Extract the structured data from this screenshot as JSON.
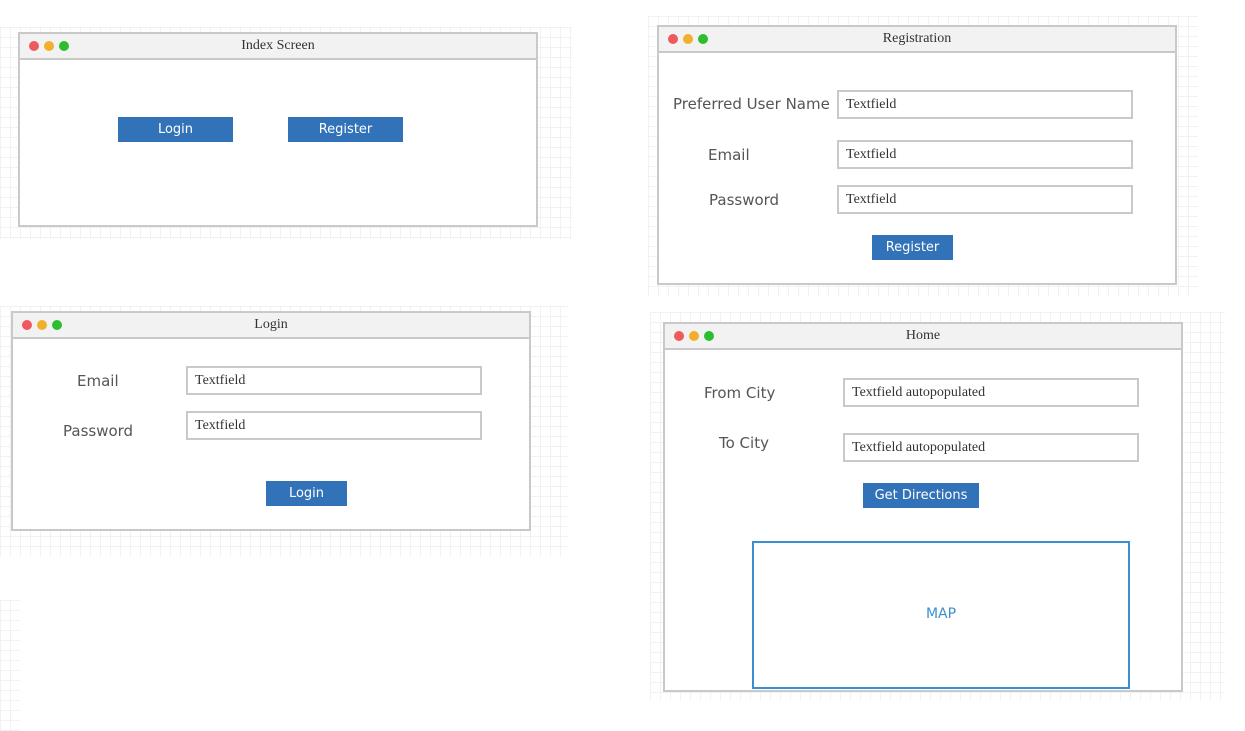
{
  "index_screen": {
    "title": "Index Screen",
    "login_button": "Login",
    "register_button": "Register"
  },
  "registration": {
    "title": "Registration",
    "username_label": "Preferred User Name",
    "username_value": "Textfield",
    "email_label": "Email",
    "email_value": "Textfield",
    "password_label": "Password",
    "password_value": "Textfield",
    "register_button": "Register"
  },
  "login": {
    "title": "Login",
    "email_label": "Email",
    "email_value": "Textfield",
    "password_label": "Password",
    "password_value": "Textfield",
    "login_button": "Login"
  },
  "home": {
    "title": "Home",
    "from_city_label": "From City",
    "from_city_value": "Textfield autopopulated",
    "to_city_label": "To City",
    "to_city_value": "Textfield autopopulated",
    "directions_button": "Get Directions",
    "map_label": "MAP"
  },
  "colors": {
    "button_blue": "#3272b8",
    "map_border": "#3a8fd1",
    "window_border": "#c9c9c9",
    "dot_red": "#ee5a5e",
    "dot_yellow": "#f1b02c",
    "dot_green": "#2ebd2e"
  }
}
